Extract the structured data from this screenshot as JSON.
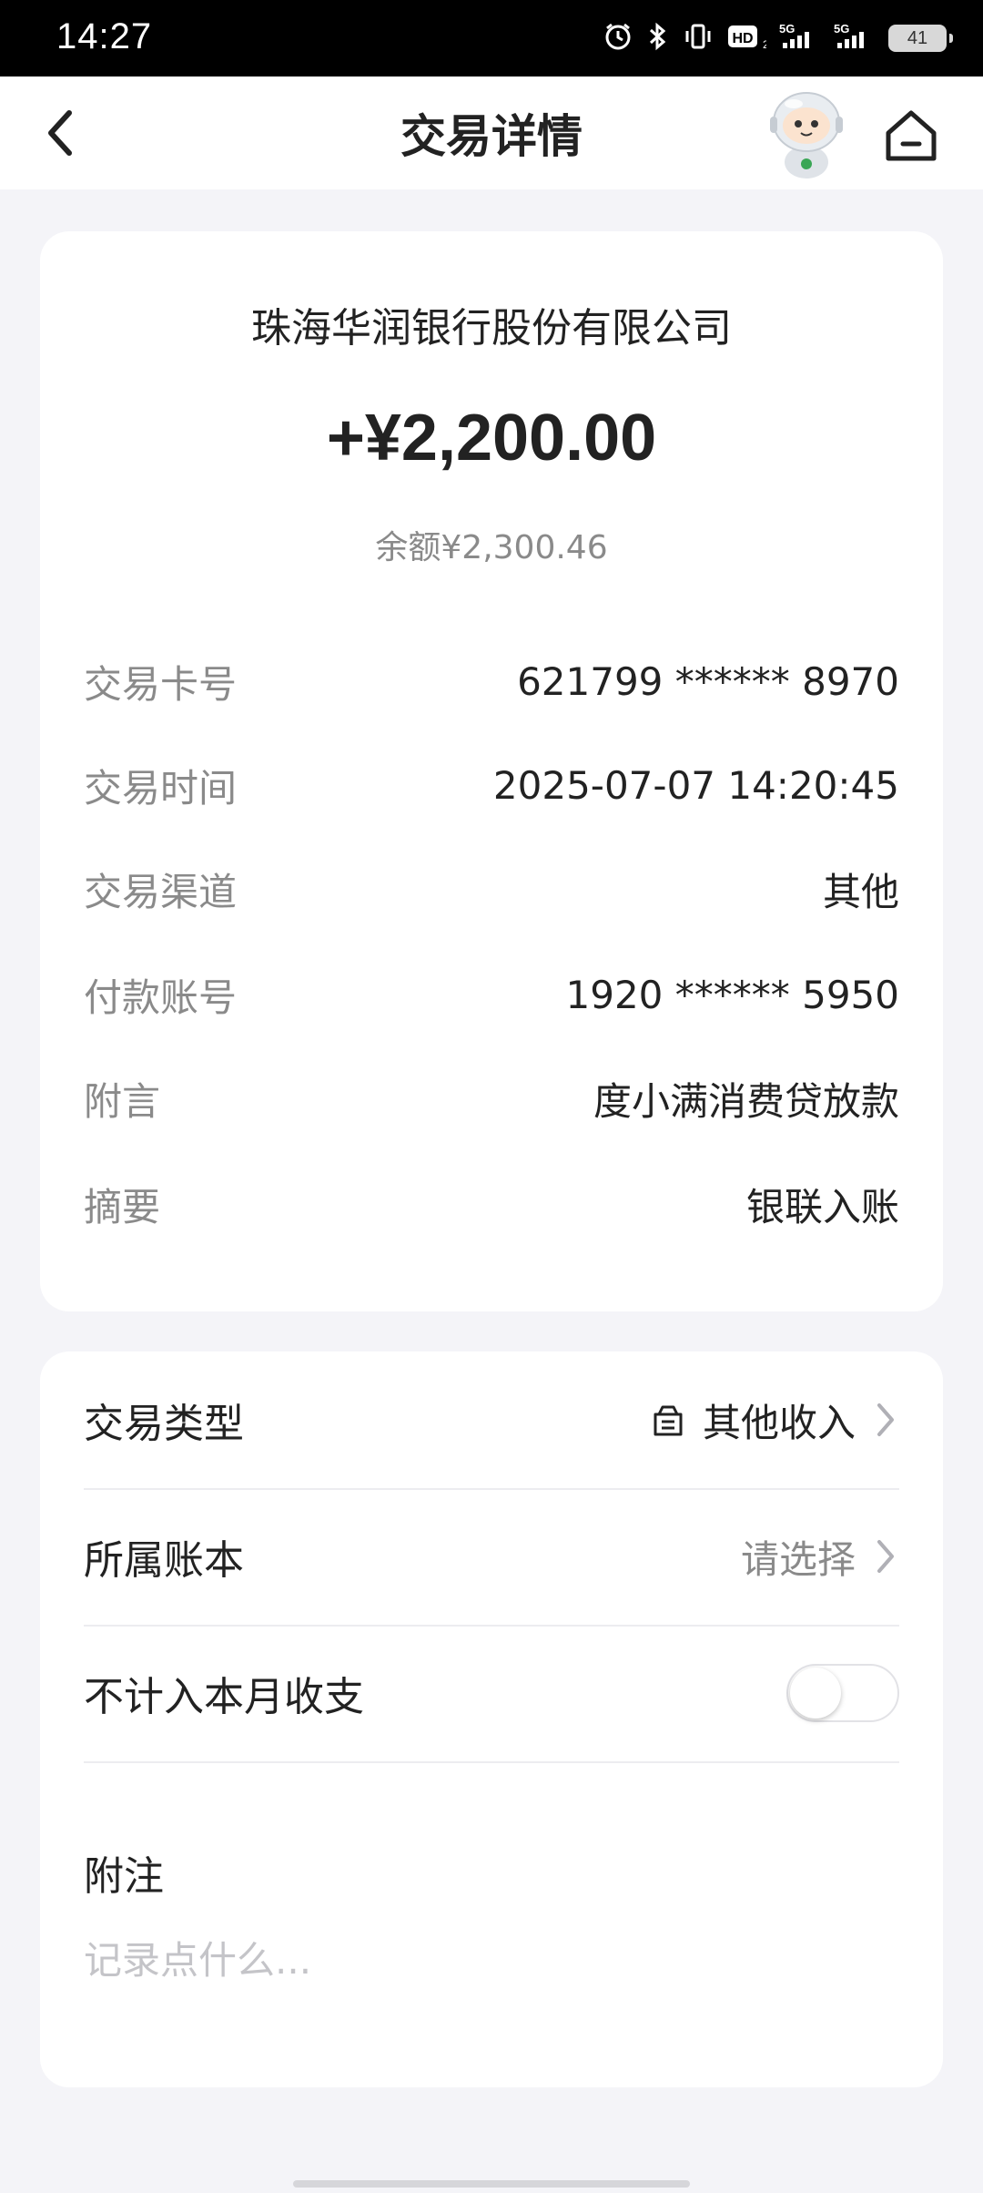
{
  "status_bar": {
    "time": "14:27",
    "battery": "41",
    "network": "5G",
    "hd": "HD"
  },
  "header": {
    "title": "交易详情"
  },
  "transaction": {
    "counterparty": "珠海华润银行股份有限公司",
    "amount": "+¥2,200.00",
    "balance": "余额¥2,300.46",
    "details": [
      {
        "label": "交易卡号",
        "value": "621799 ****** 8970"
      },
      {
        "label": "交易时间",
        "value": "2025-07-07 14:20:45"
      },
      {
        "label": "交易渠道",
        "value": "其他"
      },
      {
        "label": "付款账号",
        "value": "1920 ****** 5950"
      },
      {
        "label": "附言",
        "value": "度小满消费贷放款"
      },
      {
        "label": "摘要",
        "value": "银联入账"
      }
    ]
  },
  "settings": {
    "type": {
      "label": "交易类型",
      "value": "其他收入",
      "icon": "category-icon"
    },
    "ledger": {
      "label": "所属账本",
      "value": "请选择"
    },
    "exclude": {
      "label": "不计入本月收支",
      "enabled": false
    },
    "note": {
      "label": "附注",
      "placeholder": "记录点什么..."
    }
  },
  "colors": {
    "background": "#f4f4f8",
    "card": "#ffffff",
    "primary_text": "#222222",
    "secondary_text": "#8a8a8a",
    "placeholder_text": "#c4c4c8",
    "assistant_accent": "#3aa655"
  }
}
